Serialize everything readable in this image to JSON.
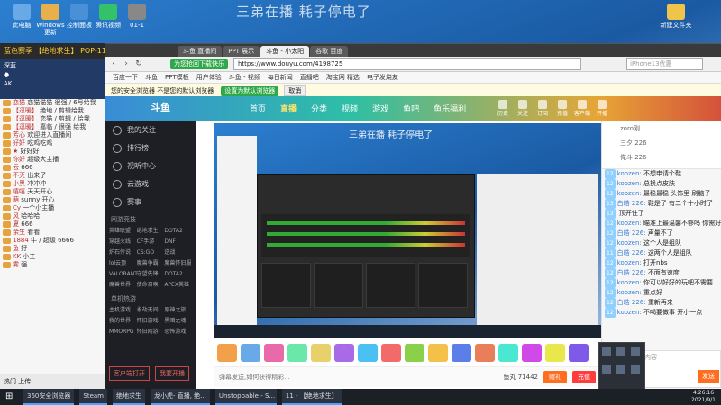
{
  "desktop": {
    "banner": "三弟在播 耗子停电了",
    "icons": [
      {
        "label": "此电脑",
        "color": "#6aa9e8"
      },
      {
        "label": "Windows 更新",
        "color": "#e8b04a"
      },
      {
        "label": "控制面板",
        "color": "#4a90d9"
      },
      {
        "label": "腾讯视频",
        "color": "#35c06a"
      },
      {
        "label": "01-1",
        "color": "#888888"
      },
      {
        "label": "新建文件夹",
        "color": "#f0c44a"
      }
    ]
  },
  "left_chat": {
    "header": "蓝色赛季 【绝地求生】 POP-11",
    "users": [
      "深蓝",
      "●",
      "AK"
    ],
    "messages": [
      {
        "name": "恋猫",
        "text": "恋猫猫猫 很强 / 6号给我"
      },
      {
        "name": "【逗暖】",
        "text": "绝地 / 剪辑给我"
      },
      {
        "name": "【逗暖】",
        "text": "恋猫 / 剪辑 / 给我"
      },
      {
        "name": "【逗暖】",
        "text": "嘉临 / 很强 给我"
      },
      {
        "name": "芳心",
        "text": "欢迎进入直播间"
      },
      {
        "name": "好好",
        "text": "吃鸡吃鸡"
      },
      {
        "name": "★",
        "text": "好好好"
      },
      {
        "name": "你好",
        "text": "超级大主播"
      },
      {
        "name": "云",
        "text": "666"
      },
      {
        "name": "不灭",
        "text": "出来了"
      },
      {
        "name": "小黑",
        "text": "冲冲冲"
      },
      {
        "name": "嘻嘻",
        "text": "天天开心"
      },
      {
        "name": "萌",
        "text": "sunny 开心"
      },
      {
        "name": "Cy",
        "text": "一个小主播"
      },
      {
        "name": "风",
        "text": "哈哈哈"
      },
      {
        "name": "夏",
        "text": "666"
      },
      {
        "name": "余生",
        "text": "看看"
      },
      {
        "name": "1884",
        "text": "牛 / 超级 6666"
      },
      {
        "name": "鱼",
        "text": "好"
      },
      {
        "name": "KK",
        "text": "小主"
      },
      {
        "name": "雾",
        "text": "强"
      }
    ],
    "footer": "热门 上传"
  },
  "browser": {
    "tabs": [
      {
        "label": "斗鱼 直播间",
        "active": false
      },
      {
        "label": "PPT 展示",
        "active": false
      },
      {
        "label": "斗鱼 - 小太阳",
        "active": true
      },
      {
        "label": "谷歌 百度",
        "active": false
      }
    ],
    "notice_badge": "为您抢回下载快乐",
    "url": "https://www.douyu.com/4198725",
    "search_placeholder": "iPhone13优惠",
    "bookmarks": [
      "百度一下",
      "斗鱼",
      "PPT模板",
      "用户体验",
      "斗鱼 - 视频",
      "每日新闻",
      "直播吧",
      "淘宝网 精选",
      "电子发烧友"
    ],
    "notice": {
      "text": "您的安全浏览器 不是您的默认浏览器",
      "ok_label": "设置为默认浏览器",
      "no_label": "取消"
    }
  },
  "douyu": {
    "logo": "斗鱼",
    "nav": [
      "首页",
      "直播",
      "分类",
      "视频",
      "游戏",
      "鱼吧",
      "鱼乐福利"
    ],
    "active_nav": "直播",
    "header_icons": [
      "历史",
      "关注",
      "订阅",
      "充值",
      "客户端",
      "开播"
    ],
    "sidebar": {
      "items": [
        "我的关注",
        "排行榜",
        "视听中心",
        "云游戏",
        "赛事"
      ],
      "section1": "网游竞技",
      "games1": [
        "英雄联盟",
        "绝地求生",
        "DOTA2",
        "穿越火线",
        "CF手游",
        "DNF",
        "炉石传说",
        "CS:GO",
        "逆战",
        "lol云顶",
        "魔兽争霸",
        "魔兽怀旧服",
        "VALORANT",
        "守望先锋",
        "DOTA2",
        "魔兽世界",
        "使命召唤",
        "APEX英雄"
      ],
      "section2": "单机热游",
      "games2": [
        "主机游戏",
        "永劫无间",
        "原神之旅",
        "我的世界",
        "怀旧游戏",
        "黑暗之魂",
        "MMORPG",
        "怀旧网游",
        "恐怖游戏"
      ],
      "btn1": "客户端打开",
      "btn2": "我要开播"
    },
    "danmu_hint": "弹幕发送,如何获得精彩...",
    "fish_count": "鱼丸 71442",
    "gift_label": "赠礼",
    "recharge": "充值"
  },
  "right_chat": {
    "rank": [
      "zoro刚",
      "三夕 226",
      "俺斗 226"
    ],
    "lines": [
      {
        "lv": "12",
        "user": "koozen:",
        "text": "不想申请个鞋"
      },
      {
        "lv": "12",
        "user": "koozen:",
        "text": "总换点皮肤"
      },
      {
        "lv": "12",
        "user": "koozen:",
        "text": "最稳最稳 头饰里 刷脑子"
      },
      {
        "lv": "13",
        "user": "白皓 226:",
        "text": "鞋是了 有二个十小时了"
      },
      {
        "lv": "13",
        "user": "",
        "text": "顶开住了"
      },
      {
        "lv": "12",
        "user": "koozen:",
        "text": "瞄准上最温馨不够吗 你需好好"
      },
      {
        "lv": "12",
        "user": "白皓 226:",
        "text": "声量不了"
      },
      {
        "lv": "12",
        "user": "koozen:",
        "text": "这个人是组队"
      },
      {
        "lv": "11",
        "user": "白皓 226:",
        "text": "这两个人是组队"
      },
      {
        "lv": "12",
        "user": "koozen:",
        "text": "打开nbs"
      },
      {
        "lv": "12",
        "user": "白皓 226:",
        "text": "不面有速度"
      },
      {
        "lv": "12",
        "user": "koozen:",
        "text": "你可以好好的玩吧不需要"
      },
      {
        "lv": "12",
        "user": "koozen:",
        "text": "重点好"
      },
      {
        "lv": "12",
        "user": "白皓 226:",
        "text": "重新再来"
      },
      {
        "lv": "12",
        "user": "koozen:",
        "text": "不喝要做事 开小一点"
      }
    ],
    "input_placeholder": "这里输入聊天内容",
    "send_label": "发送"
  },
  "taskbar": {
    "start": "⊞",
    "apps": [
      "360安全浏览器",
      "Steam",
      "绝地求生",
      "龙小虎- 直播, 绝...",
      "Unstoppable - S...",
      "11 - 【绝地求生】"
    ],
    "time": "4:26:16",
    "date": "2021/9/1"
  }
}
